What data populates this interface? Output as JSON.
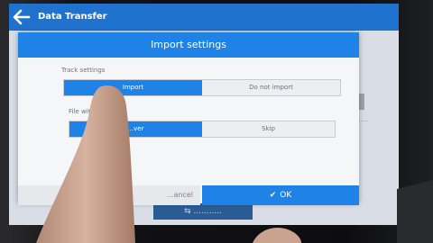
{
  "app": {
    "title": "Data Transfer",
    "header_color": "#1f73cf",
    "back_icon": "arrow-left-icon"
  },
  "background": {
    "bottom_button_label": "⇆ ...........",
    "right_caption": "............"
  },
  "dialog": {
    "title": "Import settings",
    "accent_color": "#1f82e6",
    "track_settings": {
      "label": "Track settings",
      "options": [
        "Import",
        "Do not import"
      ],
      "selected_index": 0
    },
    "file_same_name": {
      "label": "File with ... name",
      "options": [
        "...ver",
        "Skip"
      ],
      "selected_index": 0
    },
    "cancel_label": "...ancel",
    "ok_label": "OK",
    "ok_icon": "check-icon"
  }
}
